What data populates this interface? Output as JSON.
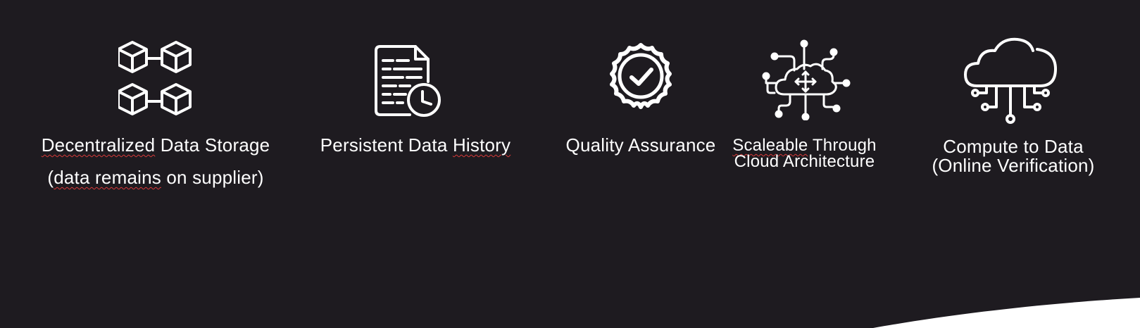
{
  "colors": {
    "background": "#1e1b20",
    "foreground": "#ffffff",
    "spellcheck": "#d83a3a",
    "wave": "#ffffff"
  },
  "features": [
    {
      "icon": "blockchain-cubes-icon",
      "label_line1_a": "Decentralized",
      "label_line1_b": " Data Storage",
      "label_line2_a": "(",
      "label_line2_b": "data remains",
      "label_line2_c": " on supplier)"
    },
    {
      "icon": "document-clock-icon",
      "label_a": "Persistent Data ",
      "label_b": "History"
    },
    {
      "icon": "quality-badge-check-icon",
      "label": "Quality Assurance"
    },
    {
      "icon": "cloud-network-icon",
      "label_line1_a": "Scaleable",
      "label_line1_b": " Through",
      "label_line2": "Cloud Architecture"
    },
    {
      "icon": "cloud-compute-icon",
      "label_line1": "Compute to Data",
      "label_line2": "(Online Verification)"
    }
  ]
}
